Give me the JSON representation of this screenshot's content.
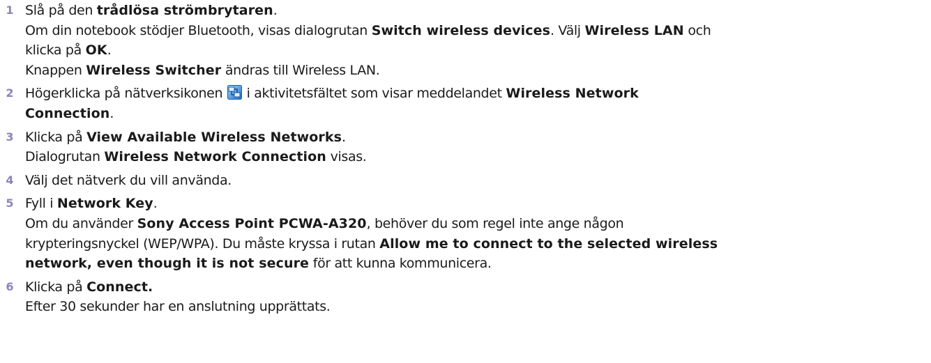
{
  "steps": [
    {
      "number": "1",
      "lines": [
        [
          {
            "t": "Slå på den ",
            "b": false
          },
          {
            "t": "trådlösa strömbrytaren",
            "b": true
          },
          {
            "t": ".",
            "b": false
          }
        ],
        [
          {
            "t": "Om din notebook stödjer Bluetooth, visas dialogrutan ",
            "b": false
          },
          {
            "t": "Switch wireless devices",
            "b": true
          },
          {
            "t": ". Välj ",
            "b": false
          },
          {
            "t": "Wireless LAN",
            "b": true
          },
          {
            "t": " och",
            "b": false
          }
        ],
        [
          {
            "t": "klicka på ",
            "b": false
          },
          {
            "t": "OK",
            "b": true
          },
          {
            "t": ".",
            "b": false
          }
        ],
        [
          {
            "t": "Knappen ",
            "b": false
          },
          {
            "t": "Wireless Switcher",
            "b": true
          },
          {
            "t": " ändras till Wireless LAN.",
            "b": false
          }
        ]
      ]
    },
    {
      "number": "2",
      "lines": [
        [
          {
            "t": "Högerklicka på nätverksikonen ",
            "b": false
          },
          {
            "icon": "network-connection-icon"
          },
          {
            "t": " i aktivitetsfältet som visar meddelandet ",
            "b": false
          },
          {
            "t": "Wireless Network",
            "b": true
          }
        ],
        [
          {
            "t": "Connection",
            "b": true
          },
          {
            "t": ".",
            "b": false
          }
        ]
      ]
    },
    {
      "number": "3",
      "lines": [
        [
          {
            "t": "Klicka på ",
            "b": false
          },
          {
            "t": "View Available Wireless Networks",
            "b": true
          },
          {
            "t": ".",
            "b": false
          }
        ],
        [
          {
            "t": "Dialogrutan ",
            "b": false
          },
          {
            "t": "Wireless Network Connection",
            "b": true
          },
          {
            "t": " visas.",
            "b": false
          }
        ]
      ]
    },
    {
      "number": "4",
      "lines": [
        [
          {
            "t": "Välj det nätverk du vill använda.",
            "b": false
          }
        ]
      ]
    },
    {
      "number": "5",
      "lines": [
        [
          {
            "t": "Fyll i ",
            "b": false
          },
          {
            "t": "Network Key",
            "b": true
          },
          {
            "t": ".",
            "b": false
          }
        ],
        [
          {
            "t": "Om du använder ",
            "b": false
          },
          {
            "t": "Sony Access Point PCWA-A320",
            "b": true
          },
          {
            "t": ", behöver du som regel inte ange någon",
            "b": false
          }
        ],
        [
          {
            "t": "krypteringsnyckel (WEP/WPA). Du måste kryssa i rutan ",
            "b": false
          },
          {
            "t": "Allow me to connect to the selected wireless",
            "b": true
          }
        ],
        [
          {
            "t": "network, even though it is not secure",
            "b": true
          },
          {
            "t": " för att kunna kommunicera.",
            "b": false
          }
        ]
      ]
    },
    {
      "number": "6",
      "lines": [
        [
          {
            "t": "Klicka på ",
            "b": false
          },
          {
            "t": "Connect.",
            "b": true
          }
        ],
        [
          {
            "t": "Efter 30 sekunder har en anslutning upprättats.",
            "b": false
          }
        ]
      ]
    }
  ],
  "colors": {
    "step_number": "#8a85b8",
    "text": "#1a1a1a"
  }
}
